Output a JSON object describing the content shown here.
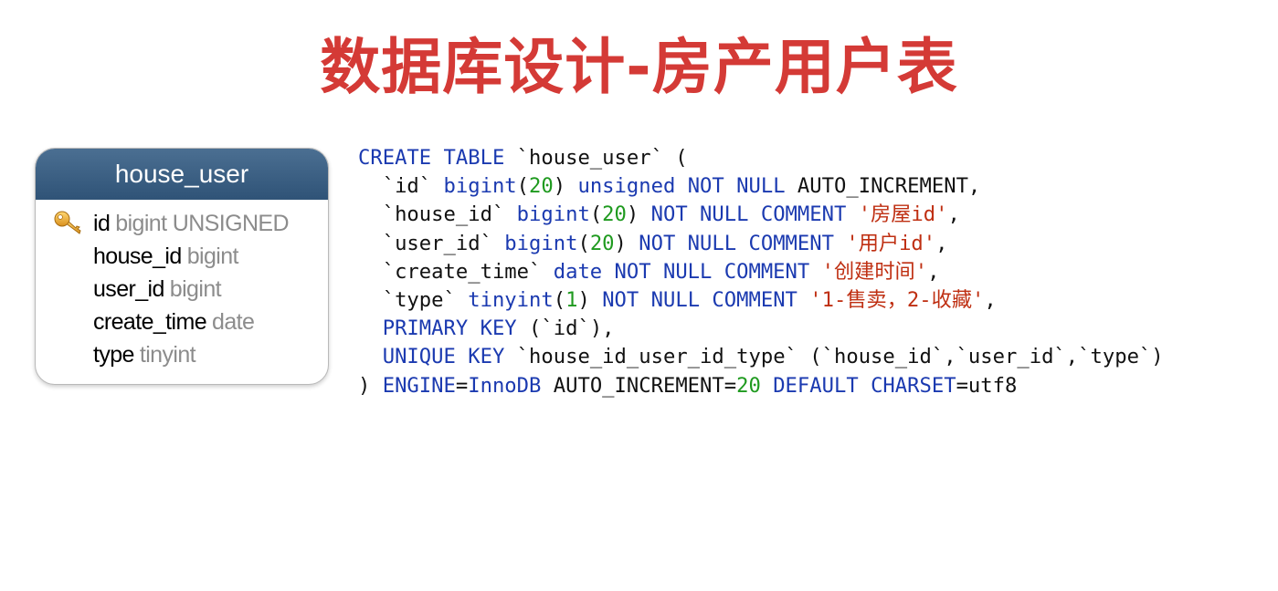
{
  "slide": {
    "title": "数据库设计-房产用户表"
  },
  "er_table": {
    "name": "house_user",
    "fields": [
      {
        "name": "id",
        "type": "bigint UNSIGNED",
        "icon": "key-icon"
      },
      {
        "name": "house_id",
        "type": "bigint"
      },
      {
        "name": "user_id",
        "type": "bigint"
      },
      {
        "name": "create_time",
        "type": "date"
      },
      {
        "name": "type",
        "type": "tinyint"
      }
    ]
  },
  "colors": {
    "title": "#d43a36",
    "keyword": "#1b3ab0",
    "number": "#1f9a1f",
    "string": "#bf2f12",
    "header": "#2f5377"
  },
  "sql": {
    "lines": [
      [
        {
          "t": "CREATE TABLE",
          "c": "kw"
        },
        {
          "t": " `house_user` ("
        }
      ],
      [
        {
          "t": "  `id` "
        },
        {
          "t": "bigint",
          "c": "kw"
        },
        {
          "t": "("
        },
        {
          "t": "20",
          "c": "num"
        },
        {
          "t": ") "
        },
        {
          "t": "unsigned NOT NULL",
          "c": "kw"
        },
        {
          "t": " AUTO_INCREMENT,"
        }
      ],
      [
        {
          "t": "  `house_id` "
        },
        {
          "t": "bigint",
          "c": "kw"
        },
        {
          "t": "("
        },
        {
          "t": "20",
          "c": "num"
        },
        {
          "t": ") "
        },
        {
          "t": "NOT NULL COMMENT",
          "c": "kw"
        },
        {
          "t": " "
        },
        {
          "t": "'房屋id'",
          "c": "str"
        },
        {
          "t": ","
        }
      ],
      [
        {
          "t": "  `user_id` "
        },
        {
          "t": "bigint",
          "c": "kw"
        },
        {
          "t": "("
        },
        {
          "t": "20",
          "c": "num"
        },
        {
          "t": ") "
        },
        {
          "t": "NOT NULL COMMENT",
          "c": "kw"
        },
        {
          "t": " "
        },
        {
          "t": "'用户id'",
          "c": "str"
        },
        {
          "t": ","
        }
      ],
      [
        {
          "t": "  `create_time` "
        },
        {
          "t": "date NOT NULL COMMENT",
          "c": "kw"
        },
        {
          "t": " "
        },
        {
          "t": "'创建时间'",
          "c": "str"
        },
        {
          "t": ","
        }
      ],
      [
        {
          "t": "  `type` "
        },
        {
          "t": "tinyint",
          "c": "kw"
        },
        {
          "t": "("
        },
        {
          "t": "1",
          "c": "num"
        },
        {
          "t": ") "
        },
        {
          "t": "NOT NULL COMMENT",
          "c": "kw"
        },
        {
          "t": " "
        },
        {
          "t": "'1-售卖，2-收藏'",
          "c": "str"
        },
        {
          "t": ","
        }
      ],
      [
        {
          "t": "  "
        },
        {
          "t": "PRIMARY KEY",
          "c": "kw"
        },
        {
          "t": " (`id`),"
        }
      ],
      [
        {
          "t": "  "
        },
        {
          "t": "UNIQUE KEY",
          "c": "kw"
        },
        {
          "t": " `house_id_user_id_type` (`house_id`,`user_id`,`type`)"
        }
      ],
      [
        {
          "t": ") "
        },
        {
          "t": "ENGINE",
          "c": "kw"
        },
        {
          "t": "="
        },
        {
          "t": "InnoDB",
          "c": "kw"
        },
        {
          "t": " AUTO_INCREMENT="
        },
        {
          "t": "20",
          "c": "num"
        },
        {
          "t": " "
        },
        {
          "t": "DEFAULT CHARSET",
          "c": "kw"
        },
        {
          "t": "=utf8"
        }
      ]
    ]
  }
}
